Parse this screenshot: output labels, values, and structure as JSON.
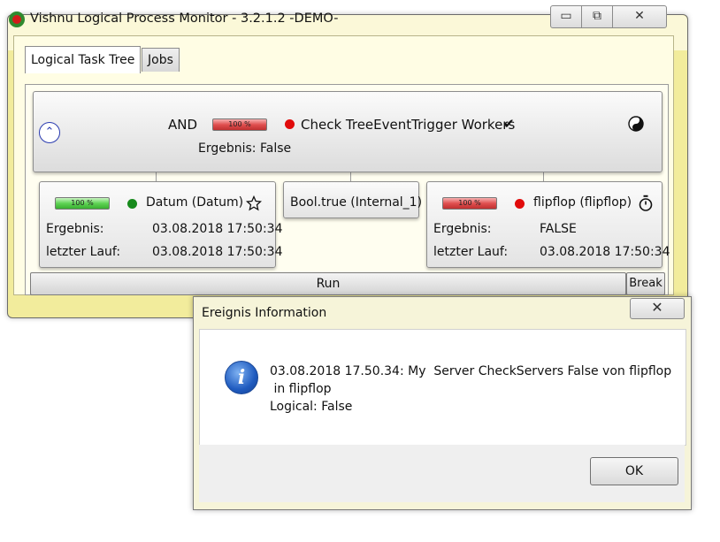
{
  "main_window": {
    "title": "Vishnu Logical Process Monitor - 3.2.1.2  -DEMO-",
    "controls": {
      "minimize": "▭",
      "maximize": "⧉",
      "close": "✕"
    }
  },
  "tabs": [
    {
      "label": "Logical Task Tree",
      "active": true
    },
    {
      "label": "Jobs",
      "active": false
    }
  ],
  "root_node": {
    "operator": "AND",
    "progress": {
      "label": "100 %",
      "value": 100,
      "status": "failed"
    },
    "status_color": "#e10b0b",
    "name": "Check TreeEventTrigger Workers",
    "check_mark": "✔",
    "result": "Ergebnis: False",
    "icon": "yin-yang-icon"
  },
  "child_nodes": [
    {
      "progress": {
        "label": "100 %",
        "value": 100,
        "status": "ok"
      },
      "status_color": "#178a1c",
      "name": "Datum (Datum)",
      "icon": "star-icon",
      "result_label": "Ergebnis:",
      "result_value": "03.08.2018 17:50:34",
      "lastrun_label": "letzter Lauf:",
      "lastrun_value": "03.08.2018 17:50:34"
    },
    {
      "name": "Bool.true (Internal_1)"
    },
    {
      "progress": {
        "label": "100 %",
        "value": 100,
        "status": "failed"
      },
      "status_color": "#e10b0b",
      "name": "flipflop (flipflop)",
      "icon": "stopwatch-icon",
      "result_label": "Ergebnis:",
      "result_value": "FALSE",
      "lastrun_label": "letzter Lauf:",
      "lastrun_value": "03.08.2018 17:50:34"
    }
  ],
  "buttons": {
    "run": "Run",
    "break": "Break"
  },
  "dialog": {
    "title": "Ereignis Information",
    "close": "✕",
    "icon": "info-icon",
    "message_line1": "03.08.2018 17.50.34: My  Server CheckServers False von flipflop",
    "message_line2": " in flipflop",
    "message_line3": "Logical: False",
    "ok": "OK"
  }
}
